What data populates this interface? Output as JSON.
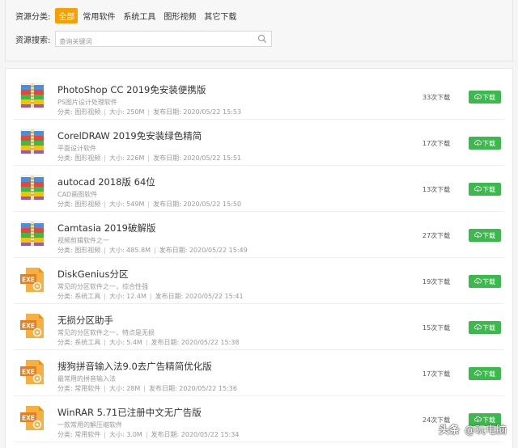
{
  "filter": {
    "category_label": "资源分类:",
    "categories": [
      {
        "label": "全部",
        "active": true
      },
      {
        "label": "常用软件",
        "active": false
      },
      {
        "label": "系统工具",
        "active": false
      },
      {
        "label": "图形视频",
        "active": false
      },
      {
        "label": "其它下载",
        "active": false
      }
    ],
    "search_label": "资源搜索:",
    "search_placeholder": "查询关键词",
    "search_value": ""
  },
  "list": {
    "download_label": "下载",
    "category_prefix": "分类:",
    "size_prefix": "大小:",
    "date_prefix": "发布日期:",
    "items": [
      {
        "title": "PhotoShop CC 2019免安装便携版",
        "desc": "PS图片设计处理软件",
        "category": "图形视频",
        "size": "250M",
        "date": "2020/05/22 15:53",
        "count": "33次下载",
        "icon": "winrar-archive-icon"
      },
      {
        "title": "CorelDRAW 2019免安装绿色精简",
        "desc": "平面设计软件",
        "category": "图形视频",
        "size": "226M",
        "date": "2020/05/22 15:51",
        "count": "17次下载",
        "icon": "winrar-archive-icon"
      },
      {
        "title": "autocad 2018版 64位",
        "desc": "CAD画图软件",
        "category": "图形视频",
        "size": "549M",
        "date": "2020/05/22 15:50",
        "count": "13次下载",
        "icon": "winrar-archive-icon"
      },
      {
        "title": "Camtasia 2019破解版",
        "desc": "视频剪辑软件之一",
        "category": "图形视频",
        "size": "485.8M",
        "date": "2020/05/22 15:49",
        "count": "27次下载",
        "icon": "winrar-archive-icon"
      },
      {
        "title": "DiskGenius分区",
        "desc": "常见的分区软件之一，综合性强",
        "category": "系统工具",
        "size": "12.4M",
        "date": "2020/05/22 15:41",
        "count": "19次下载",
        "icon": "exe-file-icon"
      },
      {
        "title": "无损分区助手",
        "desc": "常见的分区软件之一，特点是无损",
        "category": "系统工具",
        "size": "5.4M",
        "date": "2020/05/22 15:38",
        "count": "15次下载",
        "icon": "exe-file-icon"
      },
      {
        "title": "搜狗拼音输入法9.0去广告精简优化版",
        "desc": "最常用的拼音输入法",
        "category": "常用软件",
        "size": "28M",
        "date": "2020/05/22 15:36",
        "count": "17次下载",
        "icon": "exe-file-icon"
      },
      {
        "title": "WinRAR 5.71已注册中文无广告版",
        "desc": "一款常用的解压缩软件",
        "category": "常用软件",
        "size": "3.0M",
        "date": "2020/05/22 15:34",
        "count": "24次下载",
        "icon": "exe-file-icon"
      }
    ]
  },
  "watermark": {
    "brand": "头条",
    "account": "@玩电脑"
  },
  "colors": {
    "accent": "#f5a000",
    "download": "#3cb94c",
    "exe": "#f39c12"
  }
}
